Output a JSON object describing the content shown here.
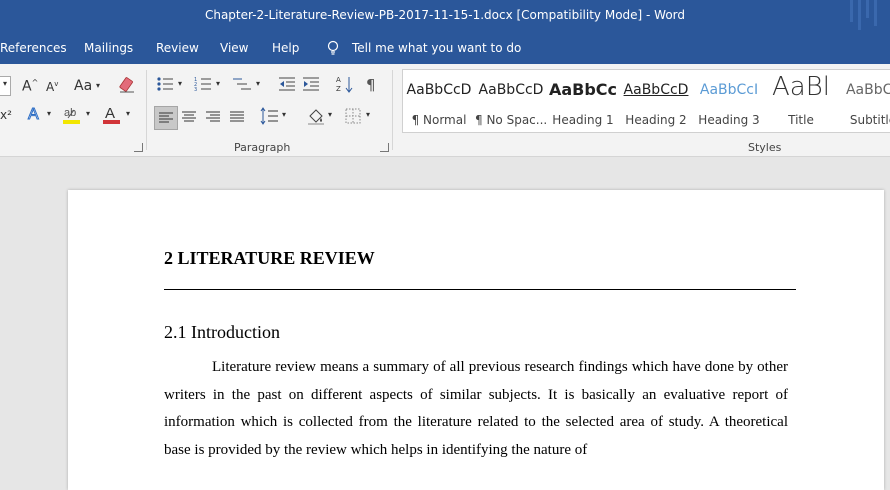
{
  "window": {
    "title": "Chapter-2-Literature-Review-PB-2017-11-15-1.docx [Compatibility Mode]  -  Word"
  },
  "menu": {
    "items": [
      "References",
      "Mailings",
      "Review",
      "View",
      "Help"
    ],
    "tell_me": "Tell me what you want to do"
  },
  "ribbon": {
    "paragraph_group": "Paragraph",
    "styles_group": "Styles",
    "font_grow": "A",
    "font_shrink": "A",
    "change_case": "Aa",
    "superscript": "x²",
    "styles": [
      {
        "sample": "AaBbCcD",
        "name": "¶ Normal"
      },
      {
        "sample": "AaBbCcD",
        "name": "¶ No Spac..."
      },
      {
        "sample": "AaBbCc",
        "name": "Heading 1"
      },
      {
        "sample": "AaBbCcD",
        "name": "Heading 2"
      },
      {
        "sample": "AaBbCcI",
        "name": "Heading 3"
      },
      {
        "sample": "AaBl",
        "name": "Title"
      },
      {
        "sample": "AaBbCc",
        "name": "Subtitle"
      }
    ],
    "colors": {
      "highlight": "#f2e600",
      "font_color": "#d13438",
      "accent": "#2b579a"
    }
  },
  "document": {
    "heading1": "2 LITERATURE REVIEW",
    "heading2": "2.1 Introduction",
    "paragraph": "Literature review means a summary of all previous research findings which have done by other writers in the past on different aspects of similar subjects. It is basically an evaluative report of information which is collected from the literature related to the selected area of study. A theoretical base is provided by the review which helps in identifying the nature of"
  }
}
